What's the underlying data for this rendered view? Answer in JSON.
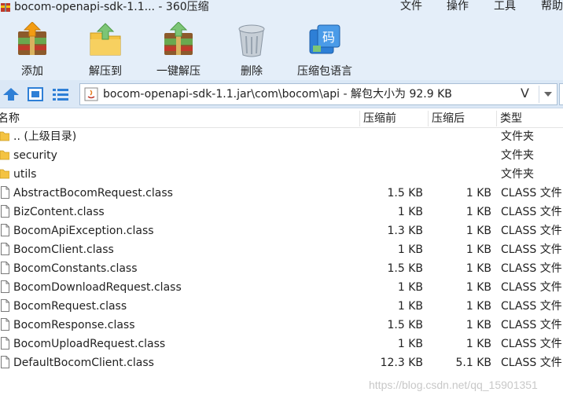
{
  "window": {
    "title": "bocom-openapi-sdk-1.1... - 360压缩",
    "app_icon": "archive-icon",
    "menu": [
      "文件",
      "操作",
      "工具",
      "帮助"
    ]
  },
  "toolbar": {
    "buttons": [
      {
        "label": "添加",
        "icon": "add-archive-icon"
      },
      {
        "label": "解压到",
        "icon": "extract-to-icon"
      },
      {
        "label": "一键解压",
        "icon": "one-click-extract-icon"
      },
      {
        "label": "删除",
        "icon": "trash-bin-icon"
      },
      {
        "label": "压缩包语言",
        "icon": "archive-language-icon"
      }
    ]
  },
  "address": {
    "path": "bocom-openapi-sdk-1.1.jar\\com\\bocom\\api - 解包大小为 92.9 KB",
    "icon": "java-file-icon",
    "v_glyph": "V"
  },
  "list": {
    "columns": {
      "name": "名称",
      "compressed": "压缩前",
      "size": "压缩后",
      "type": "类型"
    },
    "rows": [
      {
        "name": ".. (上级目录)",
        "compressed": "",
        "size": "",
        "type": "文件夹",
        "icon": "folder-icon"
      },
      {
        "name": "security",
        "compressed": "",
        "size": "",
        "type": "文件夹",
        "icon": "folder-icon"
      },
      {
        "name": "utils",
        "compressed": "",
        "size": "",
        "type": "文件夹",
        "icon": "folder-icon"
      },
      {
        "name": "AbstractBocomRequest.class",
        "compressed": "1.5 KB",
        "size": "1 KB",
        "type": "CLASS 文件",
        "icon": "file-icon"
      },
      {
        "name": "BizContent.class",
        "compressed": "1 KB",
        "size": "1 KB",
        "type": "CLASS 文件",
        "icon": "file-icon"
      },
      {
        "name": "BocomApiException.class",
        "compressed": "1.3 KB",
        "size": "1 KB",
        "type": "CLASS 文件",
        "icon": "file-icon"
      },
      {
        "name": "BocomClient.class",
        "compressed": "1 KB",
        "size": "1 KB",
        "type": "CLASS 文件",
        "icon": "file-icon"
      },
      {
        "name": "BocomConstants.class",
        "compressed": "1.5 KB",
        "size": "1 KB",
        "type": "CLASS 文件",
        "icon": "file-icon"
      },
      {
        "name": "BocomDownloadRequest.class",
        "compressed": "1 KB",
        "size": "1 KB",
        "type": "CLASS 文件",
        "icon": "file-icon"
      },
      {
        "name": "BocomRequest.class",
        "compressed": "1 KB",
        "size": "1 KB",
        "type": "CLASS 文件",
        "icon": "file-icon"
      },
      {
        "name": "BocomResponse.class",
        "compressed": "1.5 KB",
        "size": "1 KB",
        "type": "CLASS 文件",
        "icon": "file-icon"
      },
      {
        "name": "BocomUploadRequest.class",
        "compressed": "1 KB",
        "size": "1 KB",
        "type": "CLASS 文件",
        "icon": "file-icon"
      },
      {
        "name": "DefaultBocomClient.class",
        "compressed": "12.3 KB",
        "size": "5.1 KB",
        "type": "CLASS 文件",
        "icon": "file-icon"
      }
    ]
  },
  "watermark": "https://blog.csdn.net/qq_15901351",
  "colors": {
    "toolbar_bg": "#e4eef9",
    "address_bg": "#dbe8f6",
    "folder": "#f4c342",
    "accent_blue": "#2e7fd6"
  }
}
